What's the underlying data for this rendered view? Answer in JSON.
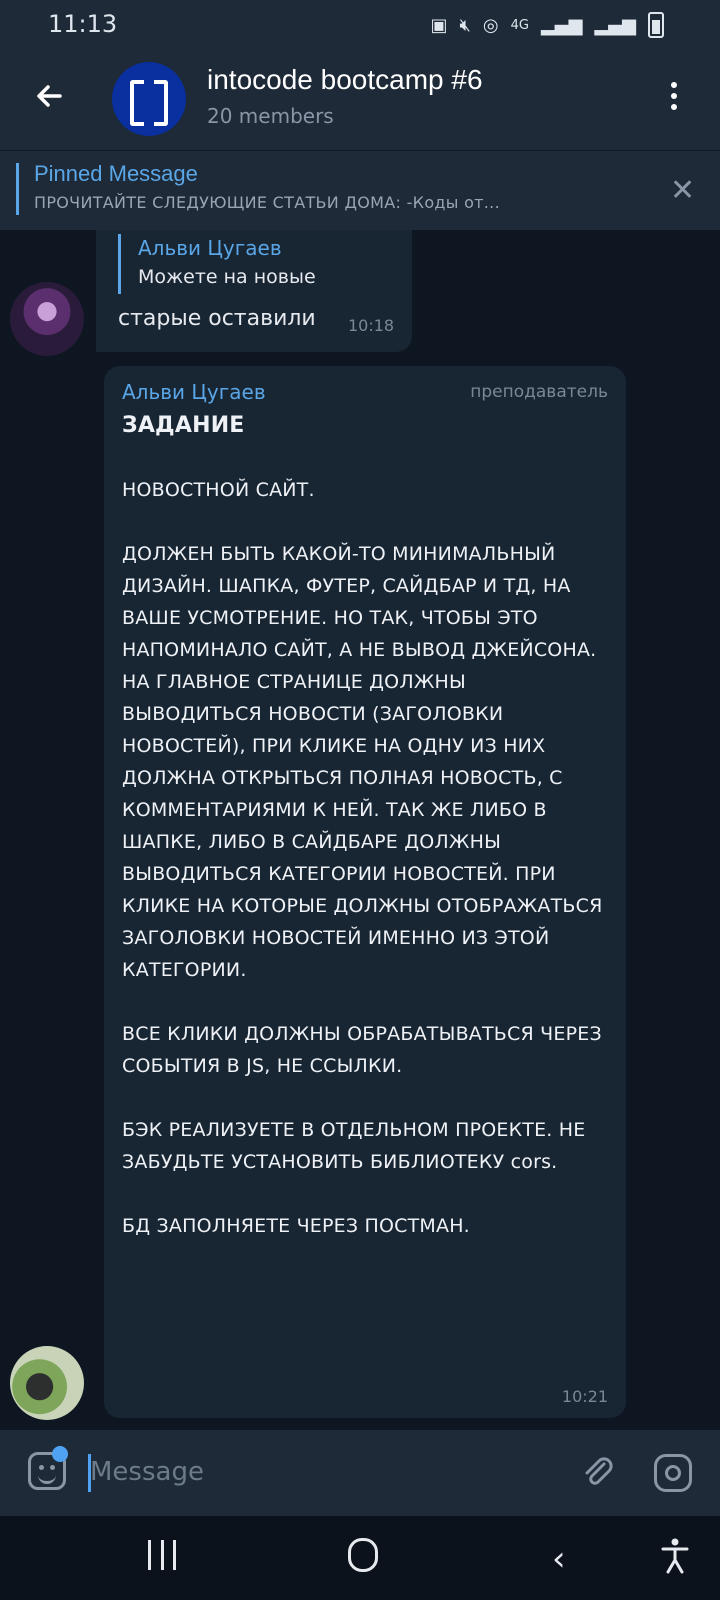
{
  "status_bar": {
    "time": "11:13",
    "icons": [
      "notification-icon",
      "mute-icon",
      "hotspot-icon",
      "volte-icon",
      "4g-icon",
      "signal-icon",
      "signal-icon-2",
      "battery-icon"
    ],
    "network_label": "4G"
  },
  "header": {
    "title": "intocode bootcamp #6",
    "subtitle": "20 members",
    "back_icon": "back-arrow-icon",
    "menu_icon": "more-vert-icon"
  },
  "pinned": {
    "title": "Pinned Message",
    "text": "ПРОЧИТАЙТЕ СЛЕДУЮЩИЕ СТАТЬИ ДОМА: -Коды от...",
    "close_icon": "close-icon"
  },
  "messages": [
    {
      "reply_author": "Альви Цугаев",
      "reply_text": "Можете на новые",
      "text": "старые оставили",
      "time": "10:18"
    },
    {
      "author": "Альви Цугаев",
      "role": "преподаватель",
      "heading": "ЗАДАНИЕ",
      "body": "\n\nНОВОСТНОЙ САЙТ.\n\nДОЛЖЕН БЫТЬ КАКОЙ-ТО МИНИМАЛЬНЫЙ ДИЗАЙН. ШАПКА, ФУТЕР, САЙДБАР И ТД, НА ВАШЕ УСМОТРЕНИЕ. НО ТАК, ЧТОБЫ ЭТО НАПОМИНАЛО САЙТ, А НЕ ВЫВОД ДЖЕЙСОНА. НА ГЛАВНОЕ СТРАНИЦЕ ДОЛЖНЫ ВЫВОДИТЬСЯ НОВОСТИ (ЗАГОЛОВКИ НОВОСТЕЙ), ПРИ КЛИКЕ НА ОДНУ ИЗ НИХ ДОЛЖНА ОТКРЫТЬСЯ ПОЛНАЯ НОВОСТЬ, С КОММЕНТАРИЯМИ К НЕЙ. ТАК ЖЕ ЛИБО В ШАПКЕ, ЛИБО В САЙДБАРЕ ДОЛЖНЫ ВЫВОДИТЬСЯ КАТЕГОРИИ НОВОСТЕЙ. ПРИ КЛИКЕ НА КОТОРЫЕ ДОЛЖНЫ ОТОБРАЖАТЬСЯ ЗАГОЛОВКИ НОВОСТЕЙ ИМЕННО ИЗ ЭТОЙ КАТЕГОРИИ.\n\nВСЕ КЛИКИ ДОЛЖНЫ ОБРАБАТЫВАТЬСЯ ЧЕРЕЗ СОБЫТИЯ В JS, НЕ ССЫЛКИ.\n\nБЭК РЕАЛИЗУЕТЕ В ОТДЕЛЬНОМ ПРОЕКТЕ. НЕ ЗАБУДЬТЕ УСТАНОВИТЬ БИБЛИОТЕКУ cors.\n\nБД ЗАПОЛНЯЕТЕ ЧЕРЕЗ ПОСТМАН.",
      "time": "10:21"
    }
  ],
  "composer": {
    "placeholder": "Message",
    "emoji_icon": "emoji-sticker-icon",
    "attach_icon": "paperclip-icon",
    "camera_icon": "instagram-camera-icon"
  },
  "nav_bar": {
    "icons": [
      "recent-apps-icon",
      "home-icon",
      "back-icon",
      "accessibility-icon"
    ]
  },
  "colors": {
    "background": "#0e1621",
    "header": "#1e2a38",
    "bubble": "#182533",
    "accent": "#5aa6e6"
  }
}
